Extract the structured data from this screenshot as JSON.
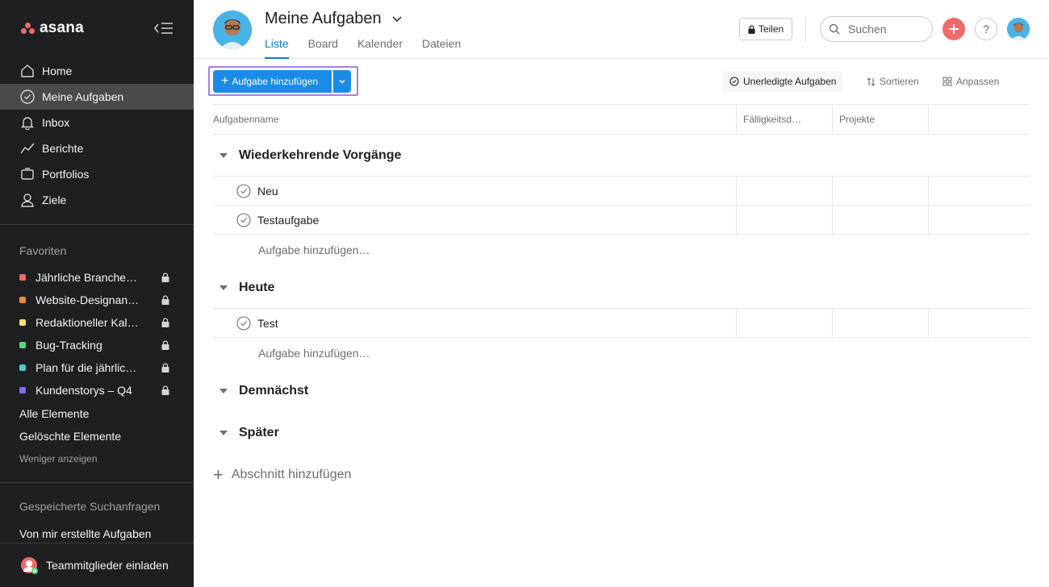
{
  "app": {
    "logo_text": "asana",
    "brand_color": "#f06a6a",
    "sidebar_bg": "#1e1f21",
    "accent": "#1a8ce8"
  },
  "sidebar": {
    "nav": [
      {
        "label": "Home",
        "icon": "home-icon"
      },
      {
        "label": "Meine Aufgaben",
        "icon": "check-circle-icon",
        "active": true
      },
      {
        "label": "Inbox",
        "icon": "bell-icon"
      },
      {
        "label": "Berichte",
        "icon": "chart-line-icon"
      },
      {
        "label": "Portfolios",
        "icon": "folder-icon"
      },
      {
        "label": "Ziele",
        "icon": "person-icon"
      }
    ],
    "favorites_title": "Favoriten",
    "favorites": [
      {
        "label": "Jährliche Branche…",
        "color": "#f06a6a"
      },
      {
        "label": "Website-Designan…",
        "color": "#ec8d3f"
      },
      {
        "label": "Redaktioneller Kal…",
        "color": "#f8df72"
      },
      {
        "label": "Bug-Tracking",
        "color": "#5cd47a"
      },
      {
        "label": "Plan für die jährlic…",
        "color": "#4ecbc4"
      },
      {
        "label": "Kundenstorys – Q4",
        "color": "#7a6ff0"
      }
    ],
    "all_items": "Alle Elemente",
    "deleted_items": "Gelöschte Elemente",
    "show_less": "Weniger anzeigen",
    "saved_searches_title": "Gespeicherte Suchanfragen",
    "my_created_tasks": "Von mir erstellte Aufgaben",
    "invite_label": "Teammitglieder einladen"
  },
  "header": {
    "title": "Meine Aufgaben",
    "tabs": [
      {
        "label": "Liste",
        "active": true
      },
      {
        "label": "Board"
      },
      {
        "label": "Kalender"
      },
      {
        "label": "Dateien"
      }
    ],
    "share_label": "Teilen",
    "search_placeholder": "Suchen",
    "help_label": "?"
  },
  "toolbar": {
    "add_task_label": "Aufgabe hinzufügen",
    "filter_label": "Unerledigte Aufgaben",
    "sort_label": "Sortieren",
    "customize_label": "Anpassen"
  },
  "table": {
    "columns": [
      "Aufgabenname",
      "Fälligkeitsd…",
      "Projekte"
    ],
    "sections": [
      {
        "title": "Wiederkehrende Vorgänge",
        "tasks": [
          "Neu",
          "Testaufgabe"
        ],
        "add_label": "Aufgabe hinzufügen…"
      },
      {
        "title": "Heute",
        "tasks": [
          "Test"
        ],
        "add_label": "Aufgabe hinzufügen…"
      },
      {
        "title": "Demnächst",
        "tasks": []
      },
      {
        "title": "Später",
        "tasks": []
      }
    ],
    "add_section_label": "Abschnitt hinzufügen"
  }
}
